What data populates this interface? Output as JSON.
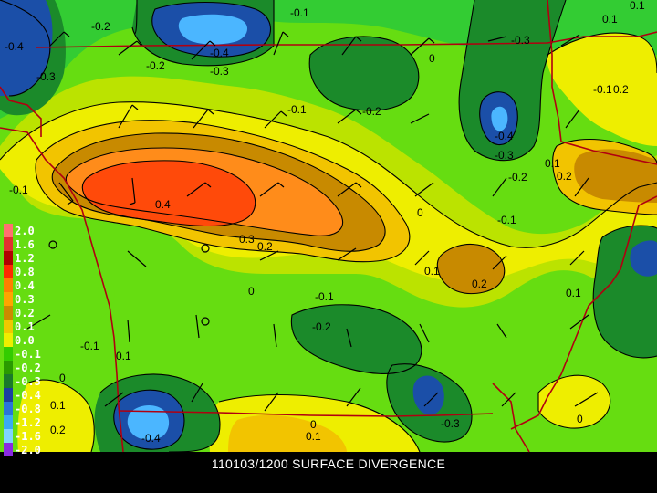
{
  "caption": "110103/1200 SURFACE DIVERGENCE",
  "colors": {
    "sea_green": "#33cc33",
    "bright_green": "#66dd11",
    "yellow_green": "#bbe300",
    "yellow": "#eeee00",
    "gold": "#f2c400",
    "brown": "#c88a00",
    "orange": "#ff8c1a",
    "red_orange": "#ff4a0a",
    "dark_green": "#1b8a2a",
    "mid_green": "#2fae3a",
    "navy": "#1b4fa8",
    "light_blue": "#4bb6ff",
    "border": "#b00010"
  },
  "legend": [
    {
      "label": "2.0",
      "color": "#ff7070"
    },
    {
      "label": "1.6",
      "color": "#e03030"
    },
    {
      "label": "1.2",
      "color": "#b00000"
    },
    {
      "label": "0.8",
      "color": "#ff2a00"
    },
    {
      "label": "0.4",
      "color": "#ff7f00"
    },
    {
      "label": "0.3",
      "color": "#ffa500"
    },
    {
      "label": "0.2",
      "color": "#cc8a00"
    },
    {
      "label": "0.1",
      "color": "#f0c800"
    },
    {
      "label": "0.0",
      "color": "#eeee00"
    },
    {
      "label": "-0.1",
      "color": "#33cc00"
    },
    {
      "label": "-0.2",
      "color": "#2a9a00"
    },
    {
      "label": "-0.3",
      "color": "#1b7a2a"
    },
    {
      "label": "-0.4",
      "color": "#1b3fa0"
    },
    {
      "label": "-0.8",
      "color": "#2a74d8"
    },
    {
      "label": "-1.2",
      "color": "#3aaaf0"
    },
    {
      "label": "-1.6",
      "color": "#7fd4ff"
    },
    {
      "label": "-2.0",
      "color": "#8a2be2"
    }
  ],
  "contour_labels": [
    {
      "text": "-0.2"
    },
    {
      "text": "-0.4"
    },
    {
      "text": "-0.3"
    },
    {
      "text": "-0.4"
    },
    {
      "text": "-0.2"
    },
    {
      "text": "-0.3"
    },
    {
      "text": "-0.1"
    },
    {
      "text": "-0.2"
    },
    {
      "text": "0"
    },
    {
      "text": "-0.3"
    },
    {
      "text": "-0.1"
    },
    {
      "text": "0.2"
    },
    {
      "text": "0.1"
    },
    {
      "text": "-0.4"
    },
    {
      "text": "-0.3"
    },
    {
      "text": "-0.2"
    },
    {
      "text": "0.1"
    },
    {
      "text": "0.2"
    },
    {
      "text": "-0.1"
    },
    {
      "text": "0.4"
    },
    {
      "text": "0.3"
    },
    {
      "text": "0.2"
    },
    {
      "text": "0"
    },
    {
      "text": "-0.1"
    },
    {
      "text": "0.1"
    },
    {
      "text": "0.2"
    },
    {
      "text": "0.1"
    },
    {
      "text": "0"
    },
    {
      "text": "-0.1"
    },
    {
      "text": "-0.2"
    },
    {
      "text": "-0.1"
    },
    {
      "text": "0.1"
    },
    {
      "text": "0"
    },
    {
      "text": "0.1"
    },
    {
      "text": "0.2"
    },
    {
      "text": "-0.4"
    },
    {
      "text": "0"
    },
    {
      "text": "0.1"
    },
    {
      "text": "-0.3"
    },
    {
      "text": "0"
    },
    {
      "text": "-0.1"
    },
    {
      "text": "0.1"
    }
  ]
}
